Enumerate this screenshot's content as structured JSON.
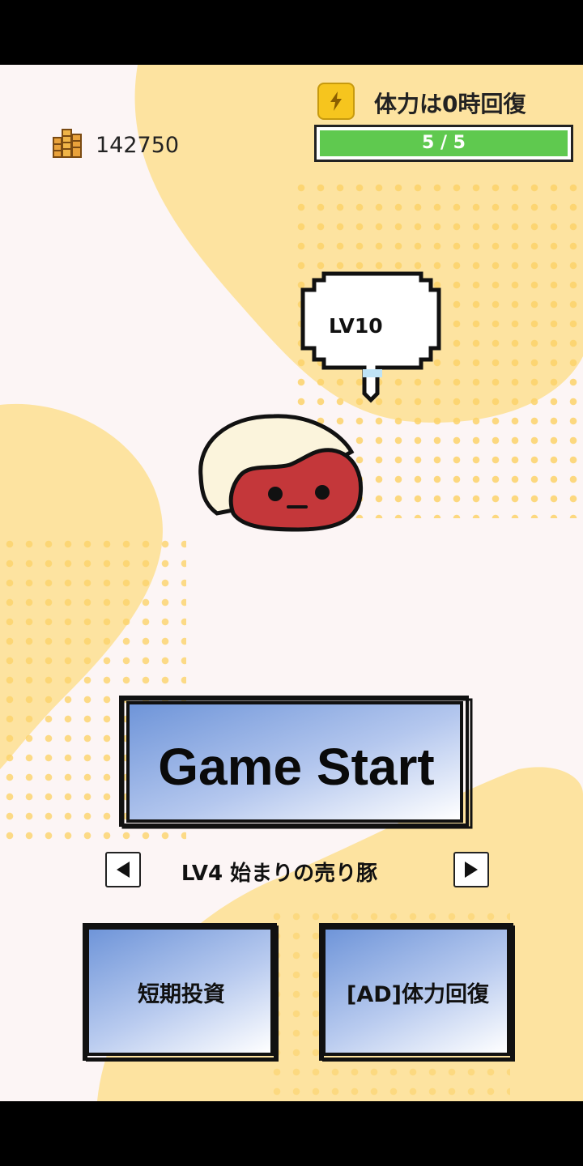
{
  "header": {
    "coins": "142750",
    "energy_notice": "体力は0時回復",
    "energy_current": 5,
    "energy_max": 5,
    "energy_label": "5 / 5"
  },
  "character": {
    "level_bubble": "LV10"
  },
  "buttons": {
    "start_label": "Game Start",
    "stage_label": "LV4 始まりの売り豚",
    "invest_label": "短期投資",
    "recover_label": "[AD]体力回復"
  },
  "icons": {
    "coin": "coin-stack-icon",
    "energy": "lightning-icon",
    "prev": "triangle-left-icon",
    "next": "triangle-right-icon"
  },
  "colors": {
    "background": "#fcf5f5",
    "blob": "#fde3a0",
    "blob_dots": "#fcd36a",
    "energy_fill": "#5fc94f",
    "button_blue": "#6f95d9",
    "character_red": "#c4373a",
    "character_fat": "#fbf4dc"
  }
}
